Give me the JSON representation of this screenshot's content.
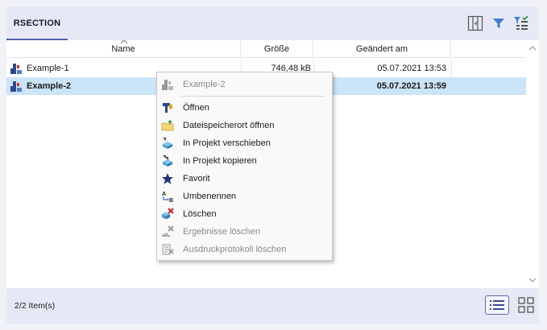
{
  "tab": {
    "label": "RSECTION"
  },
  "columns": {
    "name": "Name",
    "size": "Größe",
    "modified": "Geändert am"
  },
  "files": [
    {
      "name": "Example-1",
      "size": "746,48 kB",
      "modified": "05.07.2021 13:53",
      "selected": false
    },
    {
      "name": "Example-2",
      "size": "",
      "modified": "05.07.2021 13:59",
      "selected": true
    }
  ],
  "context_menu": {
    "header": "Example-2",
    "items": [
      {
        "label": "Öffnen",
        "icon": "open-icon",
        "disabled": false
      },
      {
        "label": "Dateispeicherort öffnen",
        "icon": "folder-icon",
        "disabled": false
      },
      {
        "label": "In Projekt verschieben",
        "icon": "move-to-project-icon",
        "disabled": false
      },
      {
        "label": "In Projekt kopieren",
        "icon": "copy-to-project-icon",
        "disabled": false
      },
      {
        "label": "Favorit",
        "icon": "star-icon",
        "disabled": false
      },
      {
        "label": "Umbenennen",
        "icon": "rename-icon",
        "disabled": false
      },
      {
        "label": "Löschen",
        "icon": "delete-icon",
        "disabled": false
      },
      {
        "label": "Ergebnisse löschen",
        "icon": "delete-results-icon",
        "disabled": true
      },
      {
        "label": "Ausdruckprotokoll löschen",
        "icon": "delete-printout-icon",
        "disabled": true
      }
    ]
  },
  "status": {
    "count_text": "2/2 Item(s)"
  },
  "colors": {
    "accent": "#5560a8",
    "selection": "#cce4f7",
    "panel": "#e6e9f5"
  }
}
